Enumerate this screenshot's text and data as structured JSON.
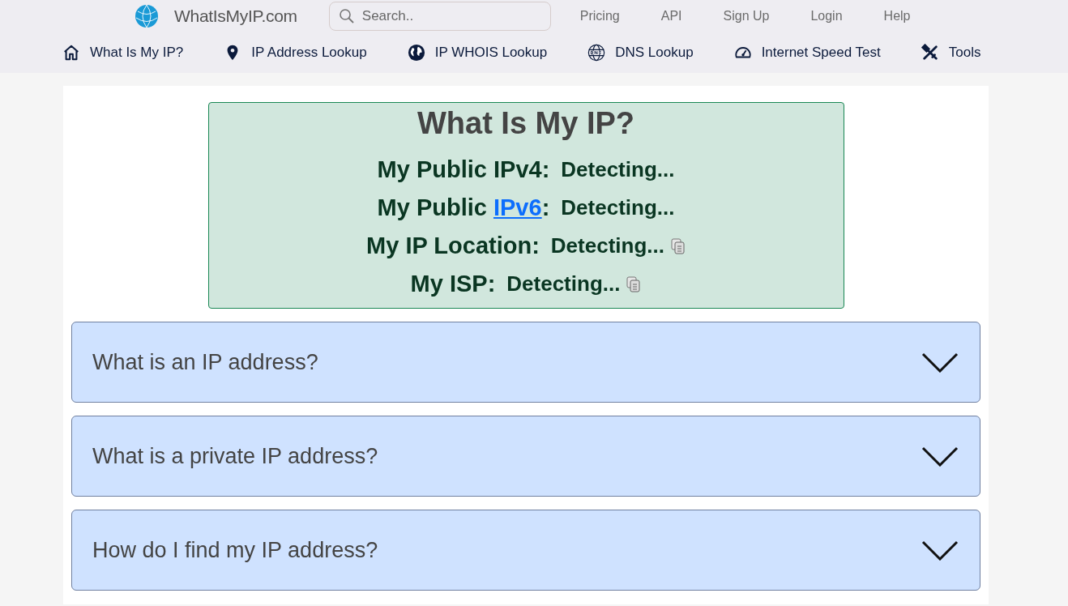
{
  "header": {
    "logo_text": "WhatIsMyIP.com",
    "search": {
      "placeholder": "Search.."
    },
    "links": [
      "Pricing",
      "API",
      "Sign Up",
      "Login",
      "Help"
    ]
  },
  "nav": [
    {
      "kind": "home",
      "label": "What Is My IP?"
    },
    {
      "kind": "pin",
      "label": "IP Address Lookup"
    },
    {
      "kind": "globe",
      "label": "IP WHOIS Lookup"
    },
    {
      "kind": "dns",
      "label": "DNS Lookup"
    },
    {
      "kind": "speed",
      "label": "Internet Speed Test"
    },
    {
      "kind": "tools",
      "label": "Tools"
    }
  ],
  "ip_panel": {
    "title": "What Is My IP?",
    "rows": [
      {
        "label": "My Public IPv4:",
        "value": "Detecting...",
        "copy": false
      },
      {
        "label": "My Public ",
        "link": "IPv6",
        "label_end": ":",
        "value": "Detecting...",
        "copy": false
      },
      {
        "label": "My IP Location:",
        "value": "Detecting...",
        "copy": true
      },
      {
        "label": "My ISP:",
        "value": "Detecting...",
        "copy": true
      }
    ]
  },
  "faq": [
    {
      "question": "What is an IP address?",
      "expanded": false
    },
    {
      "question": "What is a private IP address?",
      "expanded": false
    },
    {
      "question": "How do I find my IP address?",
      "expanded": false
    }
  ]
}
